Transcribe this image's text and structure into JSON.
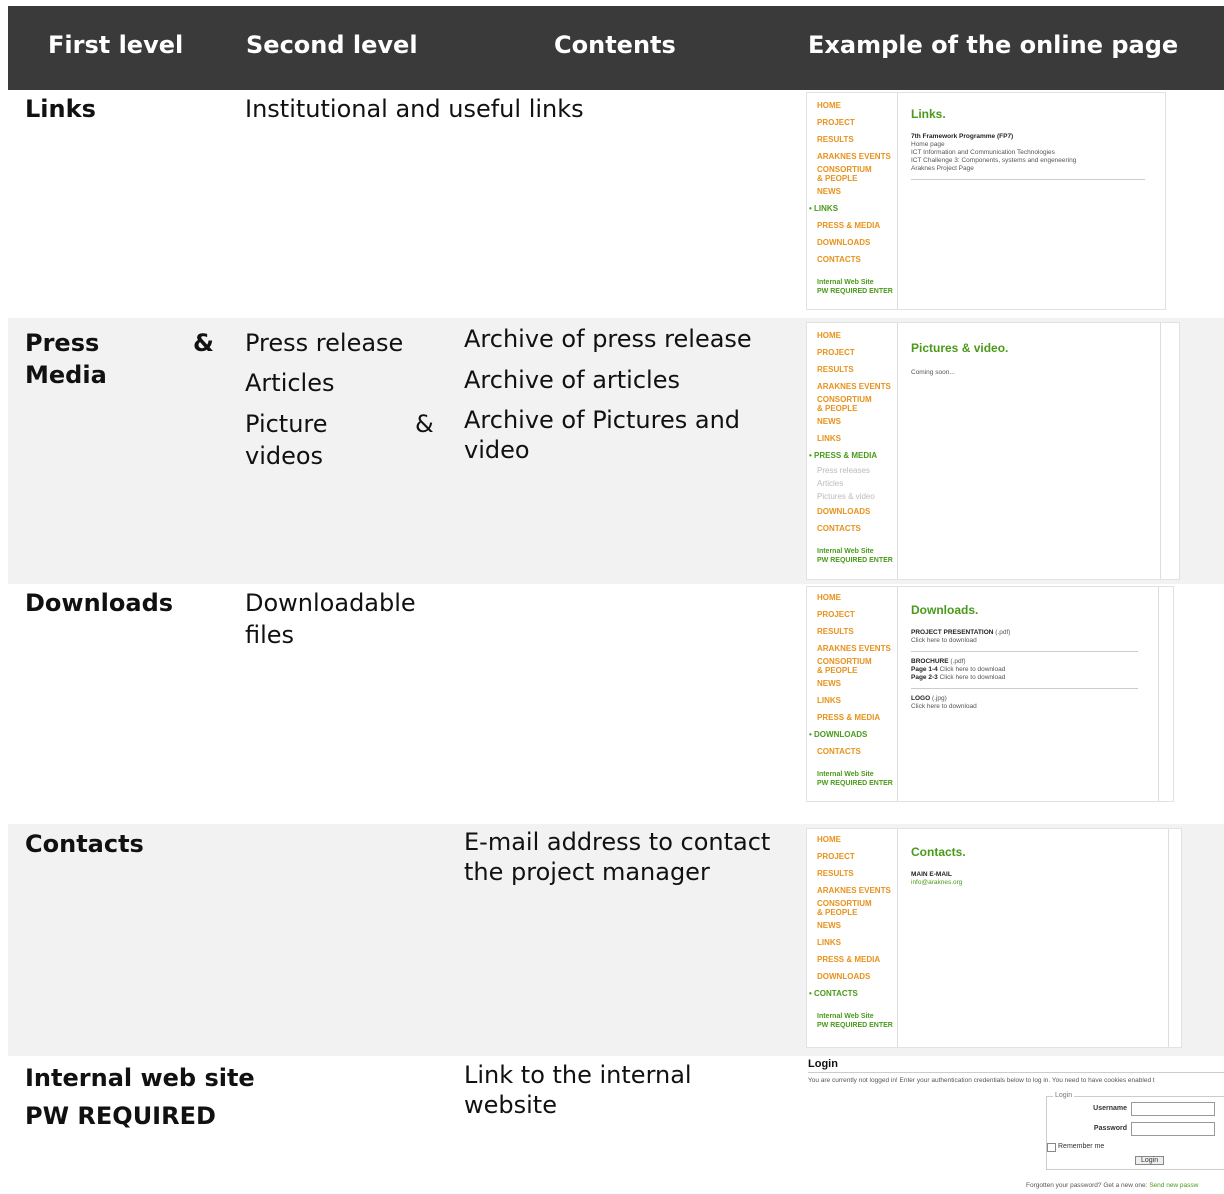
{
  "header": {
    "c1": "First level",
    "c2": "Second level",
    "c3": "Contents",
    "c4": "Example of the online page"
  },
  "rows": {
    "links": {
      "first": "Links",
      "second": "Institutional and useful links"
    },
    "press": {
      "first1": "Press",
      "amp": "&",
      "first2": "Media",
      "s1": "Press release",
      "s2": "Articles",
      "s3a": "Picture",
      "s3amp": "&",
      "s3b": "videos",
      "c1": "Archive of press release",
      "c2": "Archive of articles",
      "c3a": "Archive of Pictures and",
      "c3b": "video"
    },
    "downloads": {
      "first": "Downloads",
      "s1": "Downloadable",
      "s2": "files"
    },
    "contacts": {
      "first": "Contacts",
      "c1": "E-mail address to contact",
      "c2": "the project manager"
    },
    "internal": {
      "first1": "Internal web site",
      "first2": "PW REQUIRED",
      "c1": "Link to the internal",
      "c2": "website"
    }
  },
  "nav": {
    "home": "HOME",
    "project": "PROJECT",
    "results": "RESULTS",
    "events": "ARAKNES EVENTS",
    "consortium1": "CONSORTIUM",
    "consortium2": "& PEOPLE",
    "news": "NEWS",
    "links": "LINKS",
    "press": "PRESS & MEDIA",
    "downloads": "DOWNLOADS",
    "contacts": "CONTACTS",
    "internal1": "Internal Web Site",
    "internal2": "PW REQUIRED ENTER",
    "sub1": "Press releases",
    "sub2": "Articles",
    "sub3": "Pictures & video"
  },
  "shots": {
    "links": {
      "title": "Links.",
      "l1": "7th Framework Programme (FP7)",
      "l2": "Home page",
      "l3": "ICT Information and Communication Technologies",
      "l4": "ICT Challenge 3: Components, systems and engeneering",
      "l5": "Araknes Project Page"
    },
    "press": {
      "title": "Pictures & video.",
      "l1": "Coming soon..."
    },
    "downloads": {
      "title": "Downloads.",
      "a1": "PROJECT PRESENTATION",
      "a1x": "(.pdf)",
      "a2": "Click here to download",
      "b1": "BROCHURE",
      "b1x": "(.pdf)",
      "b2": "Page 1-4",
      "b2x": "Click here to download",
      "b3": "Page 2-3",
      "b3x": "Click here to download",
      "c1": "LOGO",
      "c1x": "(.jpg)",
      "c2": "Click here to download"
    },
    "contacts": {
      "title": "Contacts.",
      "l1": "MAIN E-MAIL",
      "l2": "info@araknes.org"
    },
    "login": {
      "title": "Login",
      "info": "You are currently not logged in! Enter your authentication credentials below to log in. You need to have cookies enabled t",
      "legend": "Login",
      "user": "Username",
      "pass": "Password",
      "remember": "Remember me",
      "btn": "Login",
      "forgot": "Forgotten your password? Get a new one:",
      "send": "Send new passw"
    }
  }
}
